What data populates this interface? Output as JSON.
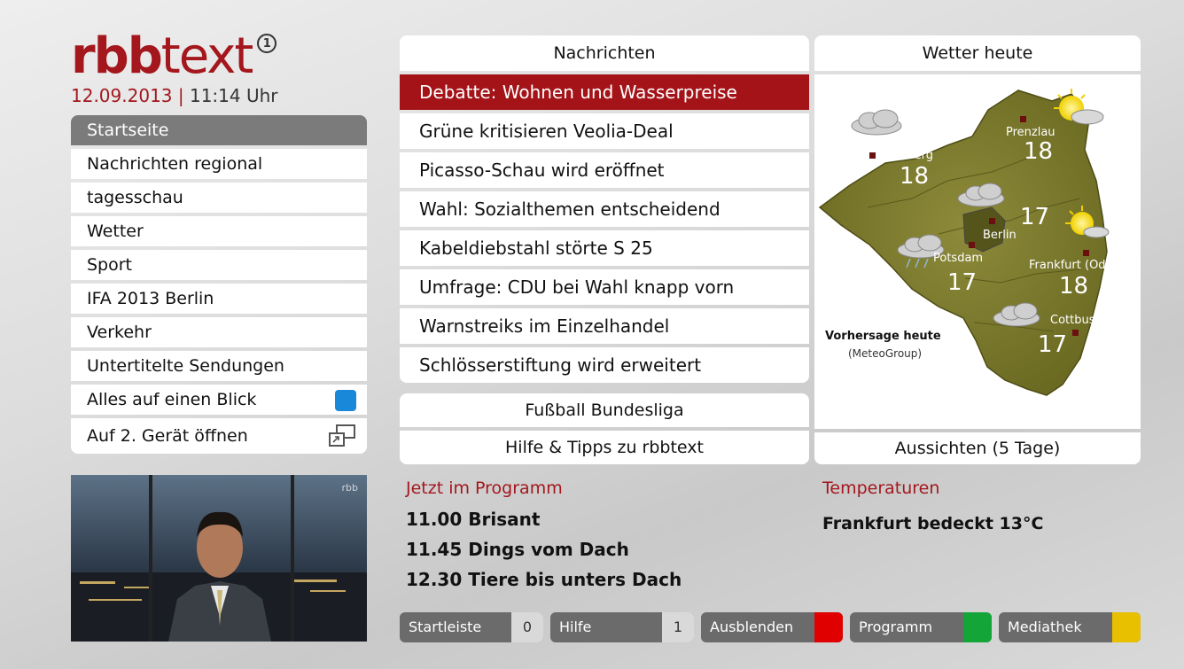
{
  "logo": {
    "brand_a": "rbb",
    "brand_b": "text",
    "mark": "1"
  },
  "header": {
    "date": "12.09.2013",
    "separator": "|",
    "time": "11:14 Uhr"
  },
  "menu": {
    "items": [
      "Startseite",
      "Nachrichten regional",
      "tagesschau",
      "Wetter",
      "Sport",
      "IFA 2013 Berlin",
      "Verkehr",
      "Untertitelte Sendungen",
      "Alles auf einen Blick",
      "Auf 2. Gerät öffnen"
    ],
    "blue_color": "#1a88d8"
  },
  "news": {
    "title": "Nachrichten",
    "items": [
      "Debatte: Wohnen und Wasserpreise",
      "Grüne kritisieren Veolia-Deal",
      "Picasso-Schau wird eröffnet",
      "Wahl: Sozialthemen entscheidend",
      "Kabeldiebstahl störte S 25",
      "Umfrage: CDU bei Wahl knapp vorn",
      "Warnstreiks im Einzelhandel",
      "Schlösserstiftung wird erweitert"
    ],
    "bundesliga": "Fußball Bundesliga",
    "help": "Hilfe & Tipps zu rbbtext",
    "accent": "#a31318"
  },
  "weather": {
    "title": "Wetter heute",
    "footer": "Aussichten (5 Tage)",
    "forecast_label": "Vorhersage heute",
    "source": "(MeteoGroup)",
    "cities": [
      {
        "name": "Prenzlau",
        "temp": "18"
      },
      {
        "name": "Perleberg",
        "temp": "18"
      },
      {
        "name": "Berlin",
        "temp": "17"
      },
      {
        "name": "Potsdam",
        "temp": "17"
      },
      {
        "name": "Frankfurt (Oder)",
        "temp": "18"
      },
      {
        "name": "Cottbus",
        "temp": "17"
      }
    ]
  },
  "video": {
    "channel_logo": "rbb"
  },
  "program": {
    "title": "Jetzt im Programm",
    "lines": [
      "11.00 Brisant",
      "11.45 Dings vom Dach",
      "12.30 Tiere bis unters Dach"
    ]
  },
  "temperatures": {
    "title": "Temperaturen",
    "line": "Frankfurt bedeckt 13°C"
  },
  "bottom_bar": {
    "startleiste": {
      "label": "Startleiste",
      "key": "0"
    },
    "hilfe": {
      "label": "Hilfe",
      "key": "1"
    },
    "ausblenden": {
      "label": "Ausblenden",
      "color": "#e00000"
    },
    "programm": {
      "label": "Programm",
      "color": "#13a538"
    },
    "mediathek": {
      "label": "Mediathek",
      "color": "#e8c000"
    }
  }
}
